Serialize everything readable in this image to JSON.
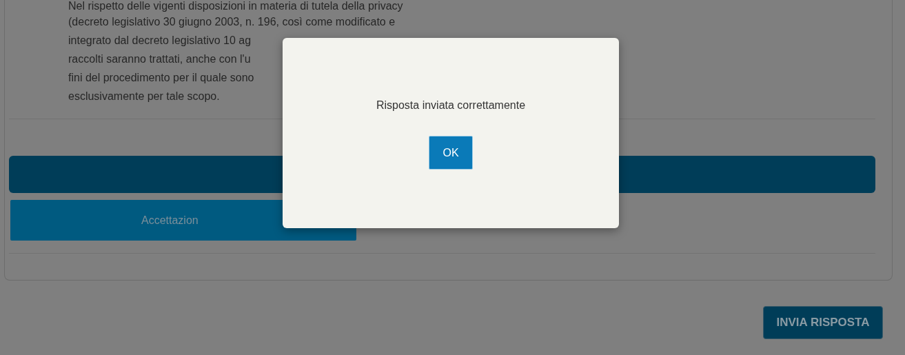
{
  "background": {
    "paragraph_lines": [
      "Nel rispetto delle vigenti disposizioni in materia di tutela della privacy",
      "(decreto legislativo 30 giugno 2003, n. 196, così come modificato e",
      "integrato dal decreto legislativo 10 ag",
      "raccolti saranno trattati, anche con l'u",
      "fini del procedimento per il quale sono",
      "esclusivamente per tale scopo."
    ],
    "accept_button": "Accettazion",
    "submit_button": "INVIA RISPOSTA"
  },
  "dialog": {
    "message": "Risposta inviata correttamente",
    "ok_button": "OK"
  }
}
